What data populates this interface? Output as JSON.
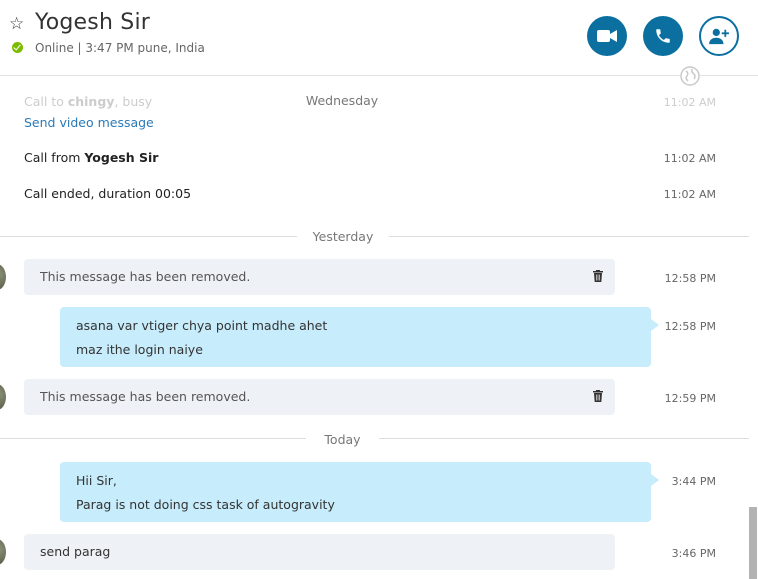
{
  "header": {
    "contact_name": "Yogesh Sir",
    "status": "Online | 3:47 PM pune, India"
  },
  "colors": {
    "accent": "#0b6fa0",
    "online": "#7cbb00",
    "outgoing_bubble": "#c7ecfb",
    "incoming_bubble": "#eef1f6"
  },
  "icons": [
    "star-icon",
    "video-call-icon",
    "phone-icon",
    "add-contact-icon",
    "globe-icon",
    "trash-icon"
  ],
  "wednesday": {
    "label": "Wednesday",
    "faded_call_prefix": "Call to ",
    "faded_call_name": "chingy",
    "faded_call_suffix": ", busy",
    "faded_time": "11:02 AM",
    "send_video": "Send video message",
    "call_from_prefix": "Call from ",
    "call_from_name": "Yogesh Sir",
    "call_from_time": "11:02 AM",
    "call_ended": "Call ended, duration 00:05",
    "call_ended_time": "11:02 AM"
  },
  "yesterday": {
    "label": "Yesterday",
    "removed1": "This message has been removed.",
    "removed1_time": "12:58 PM",
    "out_line1": "asana var vtiger chya point madhe ahet",
    "out_line2": "maz  ithe login naiye",
    "out_time": "12:58 PM",
    "removed2": "This message has been removed.",
    "removed2_time": "12:59 PM"
  },
  "today": {
    "label": "Today",
    "out_line1": "Hii Sir,",
    "out_line2": "Parag is not doing css task of autogravity",
    "out_time": "3:44 PM",
    "in_msg": "send parag",
    "in_time": "3:46 PM"
  }
}
